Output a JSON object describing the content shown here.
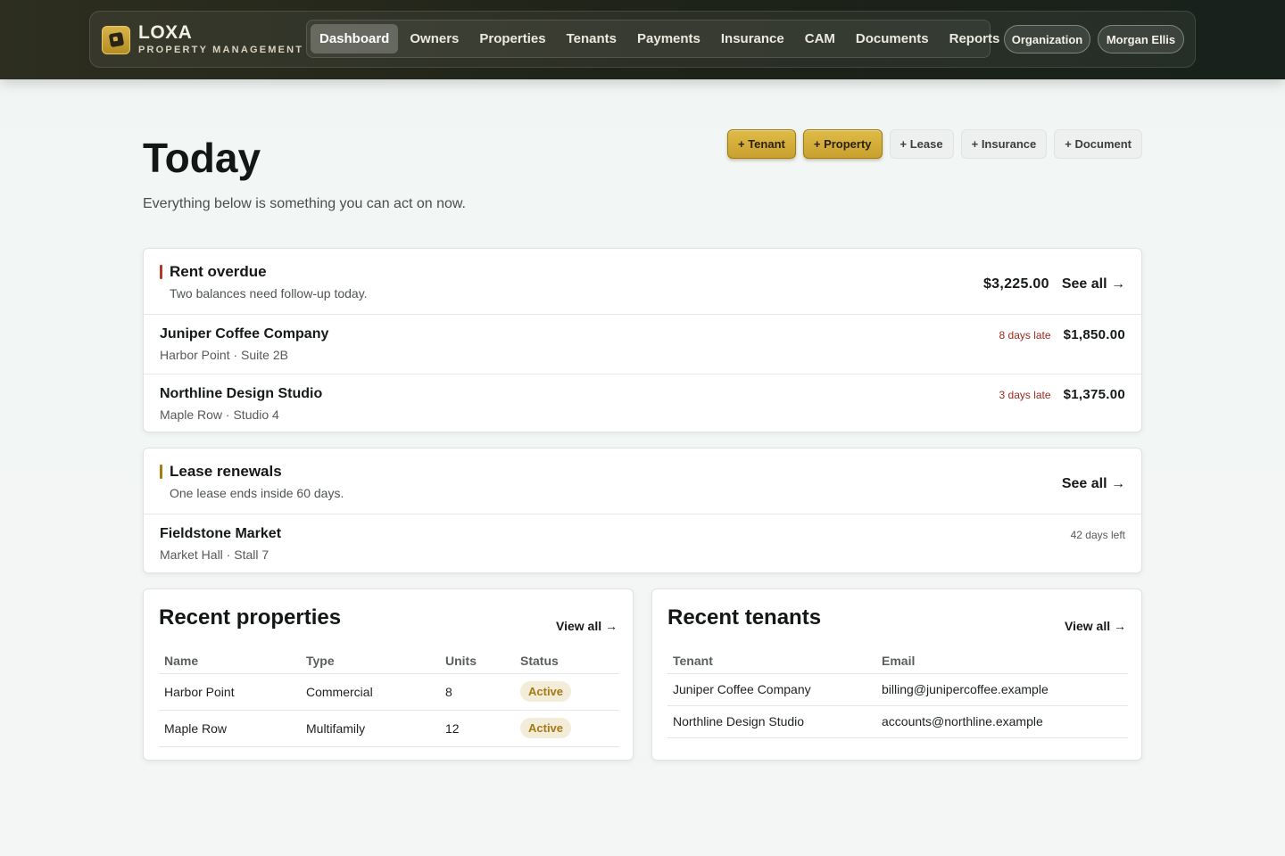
{
  "brand": {
    "name": "LOXA",
    "subtitle": "PROPERTY MANAGEMENT"
  },
  "nav": {
    "items": [
      "Dashboard",
      "Owners",
      "Properties",
      "Tenants",
      "Payments",
      "Insurance",
      "CAM",
      "Documents",
      "Reports"
    ],
    "active": "Dashboard"
  },
  "header_buttons": {
    "organization": "Organization",
    "user": "Morgan Ellis"
  },
  "page": {
    "title": "Today",
    "subtitle": "Everything below is something you can act on now."
  },
  "actions": {
    "tenant": "+ Tenant",
    "property": "+ Property",
    "lease": "+ Lease",
    "insurance": "+ Insurance",
    "document": "+ Document"
  },
  "rent_overdue": {
    "title": "Rent overdue",
    "description": "Two balances need follow-up today.",
    "total": "$3,225.00",
    "see_all": "See all →",
    "accent_color": "#b3392c",
    "rows": [
      {
        "name": "Juniper Coffee Company",
        "location": "Harbor Point · Suite 2B",
        "late": "8 days late",
        "amount": "$1,850.00"
      },
      {
        "name": "Northline Design Studio",
        "location": "Maple Row · Studio 4",
        "late": "3 days late",
        "amount": "$1,375.00"
      }
    ]
  },
  "lease_renewals": {
    "title": "Lease renewals",
    "description": "One lease ends inside 60 days.",
    "see_all": "See all →",
    "accent_color": "#a67d12",
    "rows": [
      {
        "name": "Fieldstone Market",
        "location": "Market Hall · Stall 7",
        "days_left": "42 days left"
      }
    ]
  },
  "recent_properties": {
    "title": "Recent properties",
    "view_all": "View all →",
    "columns": [
      "Name",
      "Type",
      "Units",
      "Status"
    ],
    "rows": [
      {
        "name": "Harbor Point",
        "type": "Commercial",
        "units": "8",
        "status": "Active"
      },
      {
        "name": "Maple Row",
        "type": "Multifamily",
        "units": "12",
        "status": "Active"
      }
    ]
  },
  "recent_tenants": {
    "title": "Recent tenants",
    "view_all": "View all →",
    "columns": [
      "Tenant",
      "Email"
    ],
    "rows": [
      {
        "tenant": "Juniper Coffee Company",
        "email": "billing@junipercoffee.example"
      },
      {
        "tenant": "Northline Design Studio",
        "email": "accounts@northline.example"
      }
    ]
  }
}
